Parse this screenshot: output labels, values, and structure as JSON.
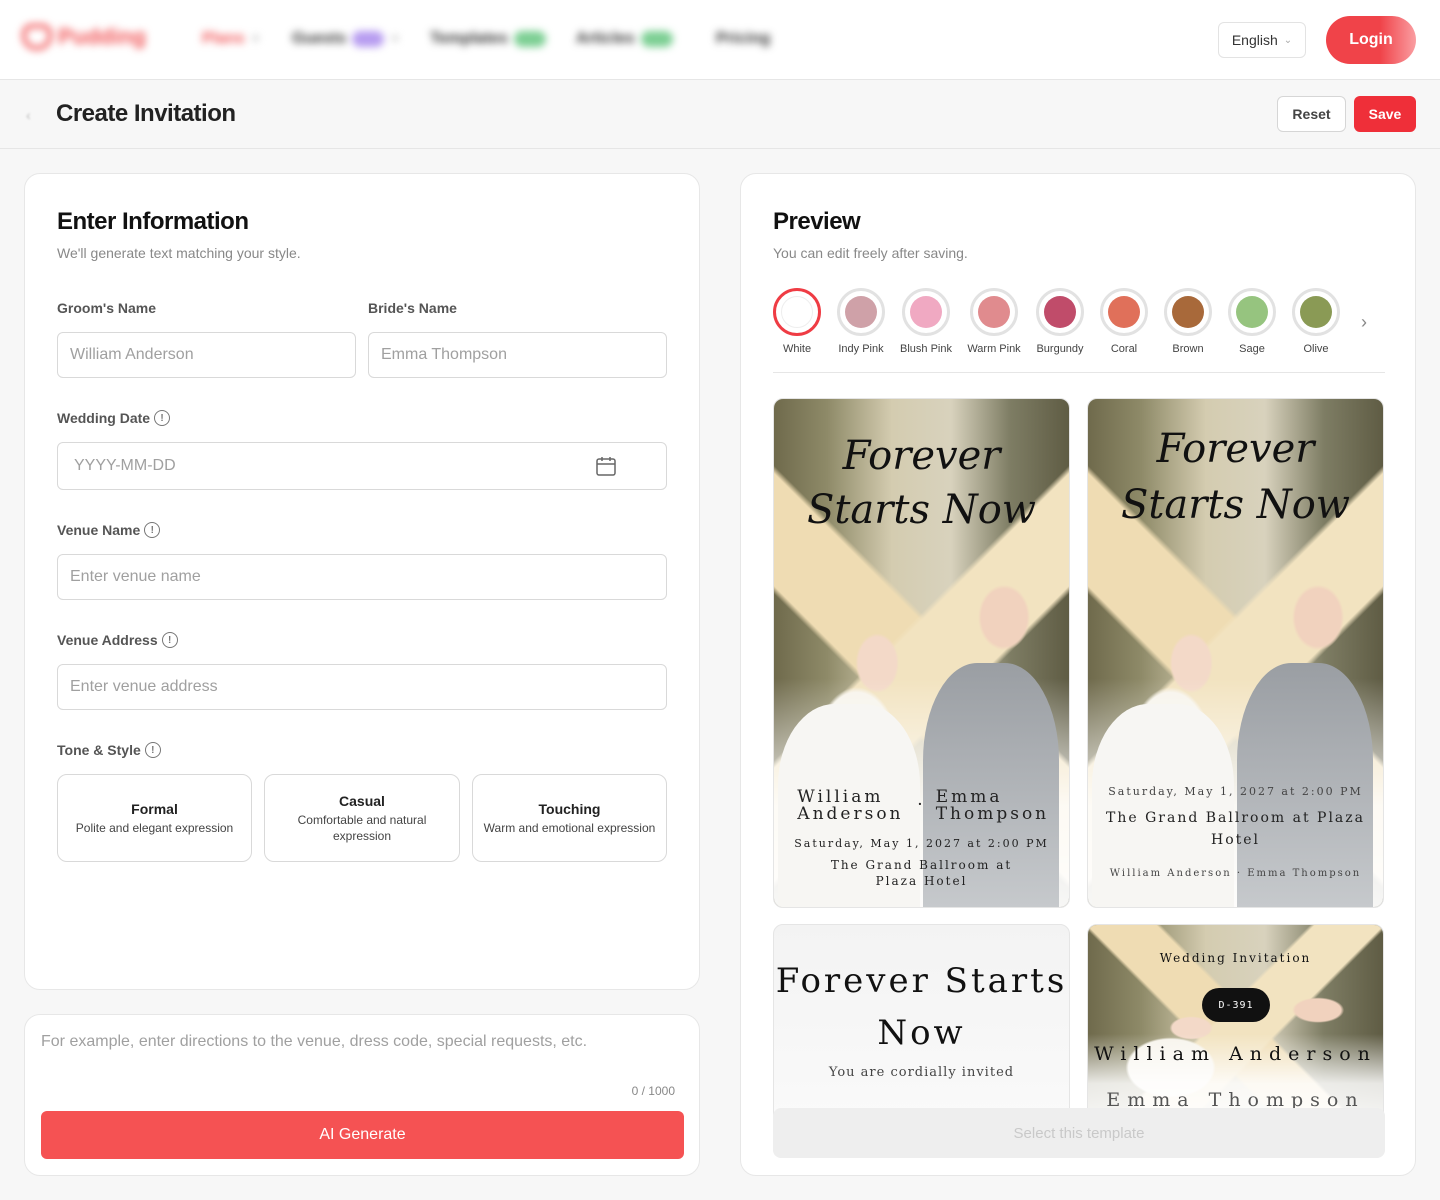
{
  "nav": {
    "brand": "Pudding",
    "items": [
      {
        "label": "Plans"
      },
      {
        "label": "Guests"
      },
      {
        "label": "Templates"
      },
      {
        "label": "Articles"
      },
      {
        "label": "Pricing"
      }
    ],
    "language": "English",
    "login_label": "Login"
  },
  "header": {
    "title": "Create Invitation",
    "reset_label": "Reset",
    "save_label": "Save"
  },
  "form": {
    "title": "Enter Information",
    "subtitle": "We'll generate text matching your style.",
    "groom_label": "Groom's Name",
    "groom_placeholder": "William Anderson",
    "bride_label": "Bride's Name",
    "bride_placeholder": "Emma Thompson",
    "date_label": "Wedding Date",
    "date_placeholder": "YYYY-MM-DD",
    "venue_name_label": "Venue Name",
    "venue_name_placeholder": "Enter venue name",
    "venue_address_label": "Venue Address",
    "venue_address_placeholder": "Enter venue address",
    "tone_label": "Tone & Style",
    "tones": [
      {
        "title": "Formal",
        "desc": "Polite and elegant expression"
      },
      {
        "title": "Casual",
        "desc": "Comfortable and natural expression"
      },
      {
        "title": "Touching",
        "desc": "Warm and emotional expression"
      }
    ]
  },
  "note": {
    "placeholder": "For example, enter directions to the venue, dress code, special requests, etc.",
    "counter": "0 / 1000",
    "generate_label": "AI Generate"
  },
  "preview": {
    "title": "Preview",
    "subtitle": "You can edit freely after saving.",
    "colors": [
      {
        "name": "White",
        "hex": "#ffffff",
        "selected": true
      },
      {
        "name": "Indy Pink",
        "hex": "#cfa1a8"
      },
      {
        "name": "Blush Pink",
        "hex": "#f0a9c2"
      },
      {
        "name": "Warm Pink",
        "hex": "#e08b8e"
      },
      {
        "name": "Burgundy",
        "hex": "#c04c6a"
      },
      {
        "name": "Coral",
        "hex": "#e0705a"
      },
      {
        "name": "Brown",
        "hex": "#a8693a"
      },
      {
        "name": "Sage",
        "hex": "#96c47f"
      },
      {
        "name": "Olive",
        "hex": "#8a9a55"
      }
    ],
    "templates": [
      {
        "headline": "Forever Starts Now",
        "groom": "William Anderson",
        "bride": "Emma Thompson",
        "separator": "·",
        "datetime": "Saturday, May 1, 2027 at 2:00 PM",
        "venue": "The Grand Ballroom at Plaza Hotel"
      },
      {
        "headline": "Forever Starts Now",
        "datetime": "Saturday, May 1, 2027 at 2:00 PM",
        "venue": "The Grand Ballroom at Plaza Hotel",
        "names": "William Anderson · Emma Thompson"
      },
      {
        "headline": "Forever Starts Now",
        "invite_line": "You are cordially invited"
      },
      {
        "kicker": "Wedding Invitation",
        "countdown": "D-391",
        "groom": "William Anderson",
        "bride": "Emma Thompson"
      }
    ],
    "select_label": "Select this template"
  }
}
